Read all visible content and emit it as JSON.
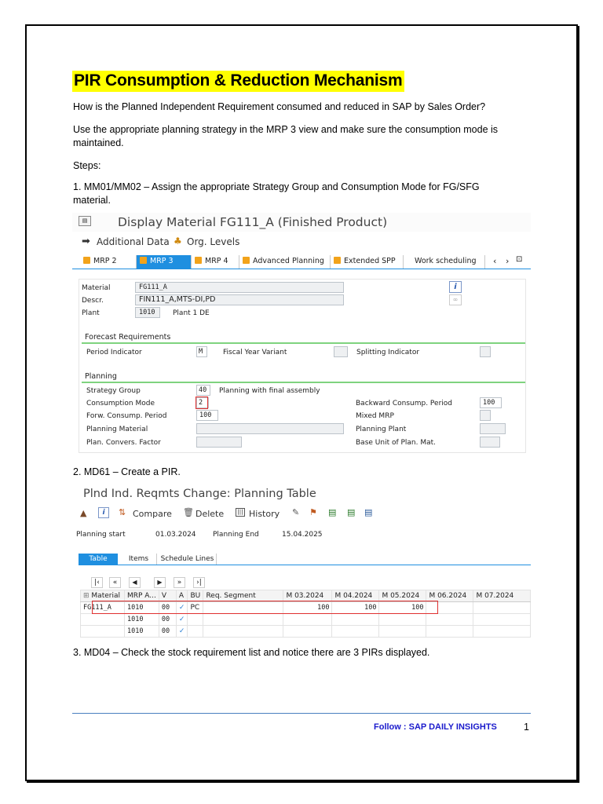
{
  "title": "PIR Consumption & Reduction Mechanism",
  "para_question": "How is the Planned Independent Requirement consumed and reduced in SAP by Sales Order?",
  "para_strategy_1": "Use the appropriate planning strategy in the MRP 3 view and make sure the consumption mode is",
  "para_strategy_2": "maintained.",
  "steps_label": "Steps:",
  "step1_line1": "1. MM01/MM02 – Assign the appropriate Strategy Group and Consumption Mode for FG/SFG",
  "step1_line2": "material.",
  "step2": "2. MD61 – Create a PIR.",
  "step3": "3. MD04 – Check the stock requirement list and notice there are 3 PIRs displayed.",
  "screen1": {
    "title": "Display Material FG111_A (Finished Product)",
    "toolbar": {
      "additional_data": "Additional Data",
      "org_levels": "Org. Levels"
    },
    "tabs": [
      "MRP 2",
      "MRP 3",
      "MRP 4",
      "Advanced Planning",
      "Extended SPP",
      "Work scheduling"
    ],
    "active_tab": "MRP 3",
    "material_label": "Material",
    "material_value": "FG111_A",
    "descr_label": "Descr.",
    "descr_value": "FIN111_A,MTS-DI,PD",
    "plant_label": "Plant",
    "plant_value": "1010",
    "plant_name": "Plant 1 DE",
    "forecast_group": "Forecast Requirements",
    "period_indicator_label": "Period Indicator",
    "period_indicator_value": "M",
    "fiscal_year_label": "Fiscal Year Variant",
    "splitting_label": "Splitting Indicator",
    "planning_group": "Planning",
    "strategy_group_label": "Strategy Group",
    "strategy_group_value": "40",
    "strategy_group_desc": "Planning with final assembly",
    "consumption_mode_label": "Consumption Mode",
    "consumption_mode_value": "2",
    "backward_label": "Backward Consump. Period",
    "backward_value": "100",
    "forward_label": "Forw. Consump. Period",
    "forward_value": "100",
    "mixed_mrp_label": "Mixed MRP",
    "planning_material_label": "Planning Material",
    "planning_plant_label": "Planning Plant",
    "conv_factor_label": "Plan. Convers. Factor",
    "base_unit_label": "Base Unit of Plan. Mat."
  },
  "screen2": {
    "title": "Plnd Ind. Reqmts Change: Planning Table",
    "toolbar": {
      "compare": "Compare",
      "delete": "Delete",
      "history": "History"
    },
    "planning_start_label": "Planning start",
    "planning_start_value": "01.03.2024",
    "planning_end_label": "Planning End",
    "planning_end_value": "15.04.2025",
    "tabs": [
      "Table",
      "Items",
      "Schedule Lines"
    ],
    "columns": [
      "Material",
      "MRP A...",
      "V",
      "A",
      "BU",
      "Req. Segment",
      "M 03.2024",
      "M 04.2024",
      "M 05.2024",
      "M 06.2024",
      "M 07.2024"
    ],
    "rows": [
      {
        "material": "FG111_A",
        "mrp_area": "1010",
        "v": "00",
        "a": "✓",
        "bu": "PC",
        "seg": "",
        "m03": "100",
        "m04": "100",
        "m05": "100",
        "m06": "",
        "m07": ""
      },
      {
        "material": "",
        "mrp_area": "1010",
        "v": "00",
        "a": "✓",
        "bu": "",
        "seg": "",
        "m03": "",
        "m04": "",
        "m05": "",
        "m06": "",
        "m07": ""
      },
      {
        "material": "",
        "mrp_area": "1010",
        "v": "00",
        "a": "✓",
        "bu": "",
        "seg": "",
        "m03": "",
        "m04": "",
        "m05": "",
        "m06": "",
        "m07": ""
      }
    ]
  },
  "footer": {
    "text": "Follow : SAP DAILY INSIGHTS",
    "page": "1"
  },
  "colors": {
    "highlight": "#ffff00",
    "sap_blue": "#1f8fe0",
    "footer_blue": "#1a1acc",
    "red_box": "#e03030"
  }
}
